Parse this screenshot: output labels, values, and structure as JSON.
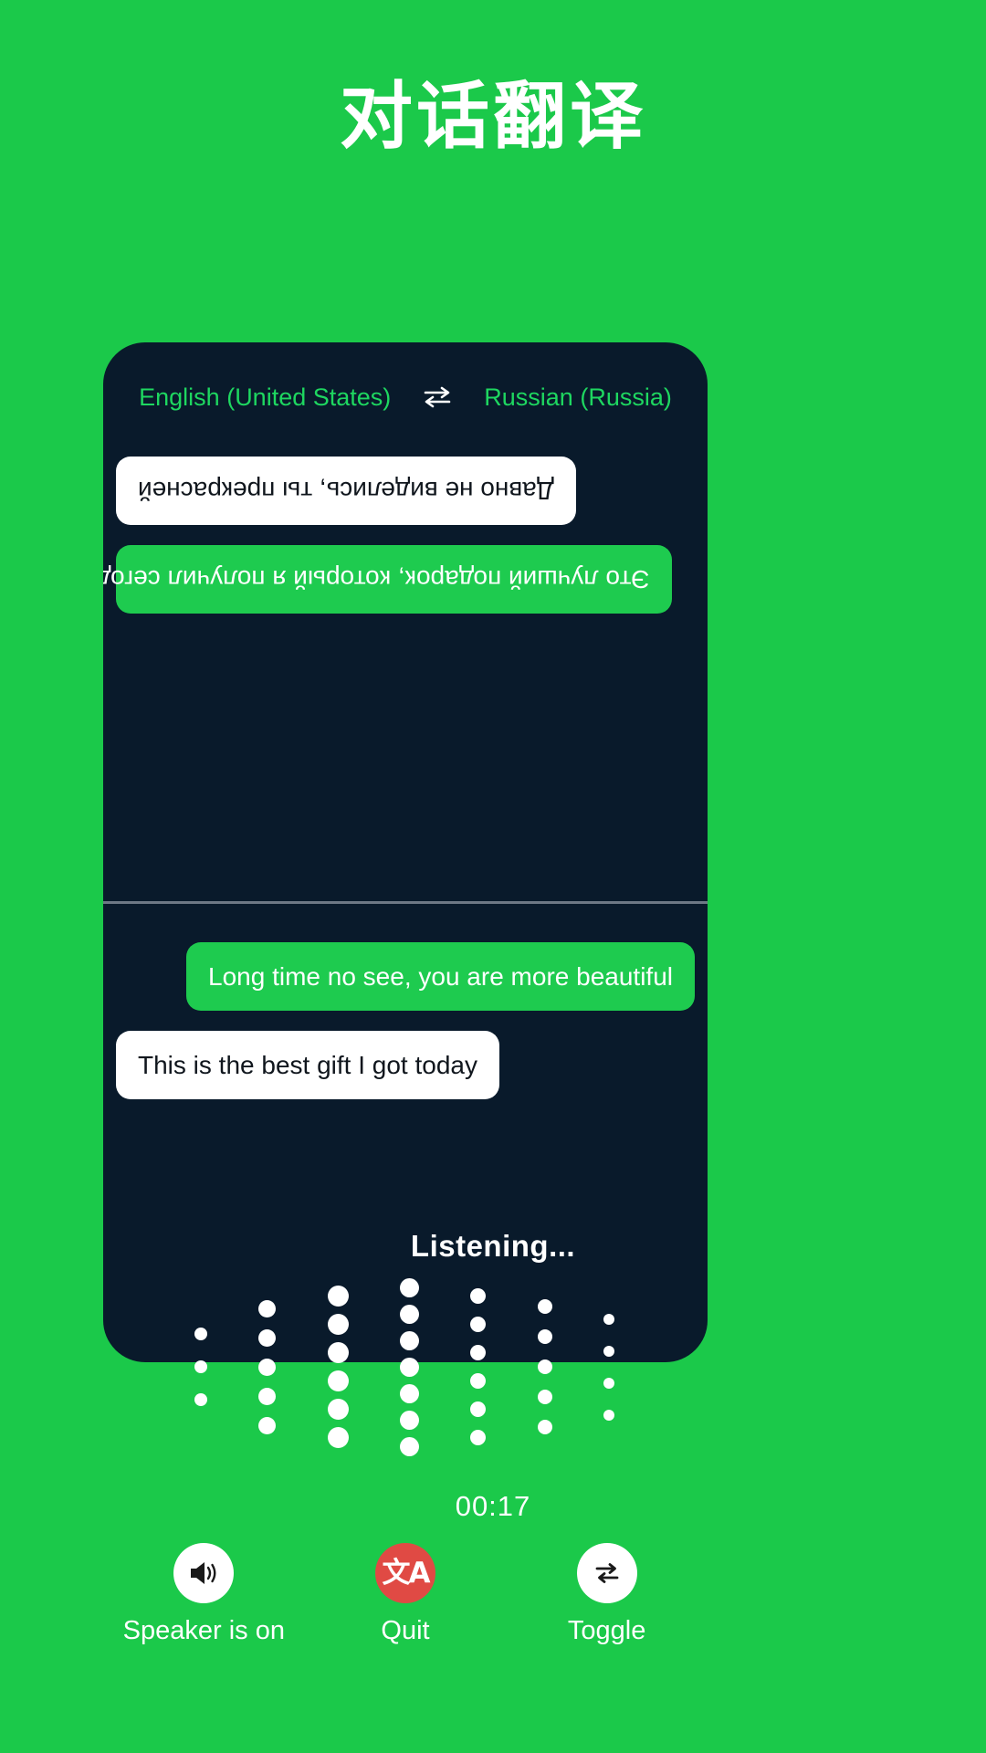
{
  "page": {
    "title": "对话翻译",
    "background_color": "#1bc94a",
    "card_color": "#091a2b"
  },
  "language_bar": {
    "source_language": "English (United States)",
    "swap_icon": "swap-horizontal-icon",
    "target_language": "Russian (Russia)",
    "text_color": "#1ed760"
  },
  "conversation": {
    "remote_pane": {
      "orientation": "rotated-180",
      "messages": [
        {
          "text": "Это лучший подарок, который я получил сегодня",
          "style": "green",
          "align": "right"
        },
        {
          "text": "Давно не виделись, ты прекрасней",
          "style": "white",
          "align": "right"
        }
      ]
    },
    "local_pane": {
      "orientation": "normal",
      "messages": [
        {
          "text": "Long time no see, you are more beautiful",
          "style": "green",
          "align": "right"
        },
        {
          "text": "This is the best gift I got today",
          "style": "white",
          "align": "left"
        }
      ]
    },
    "bubble_green_color": "#1ecb4f",
    "bubble_white_color": "#ffffff"
  },
  "listening": {
    "label": "Listening...",
    "timer": "00:17",
    "waveform": {
      "dot_color": "#ffffff",
      "columns": [
        {
          "count": 3,
          "size": 14,
          "gap": 22
        },
        {
          "count": 5,
          "size": 19,
          "gap": 13
        },
        {
          "count": 6,
          "size": 23,
          "gap": 8
        },
        {
          "count": 7,
          "size": 21,
          "gap": 8
        },
        {
          "count": 6,
          "size": 17,
          "gap": 14
        },
        {
          "count": 5,
          "size": 16,
          "gap": 17
        },
        {
          "count": 4,
          "size": 12,
          "gap": 23
        }
      ]
    }
  },
  "controls": [
    {
      "id": "speaker",
      "icon": "speaker-on-icon",
      "label": "Speaker is on",
      "circle_color": "#ffffff"
    },
    {
      "id": "quit",
      "icon": "translate-icon",
      "label": "Quit",
      "circle_color": "#e04a44",
      "glyph": "文A"
    },
    {
      "id": "toggle",
      "icon": "toggle-swap-icon",
      "label": "Toggle",
      "circle_color": "#ffffff"
    }
  ]
}
